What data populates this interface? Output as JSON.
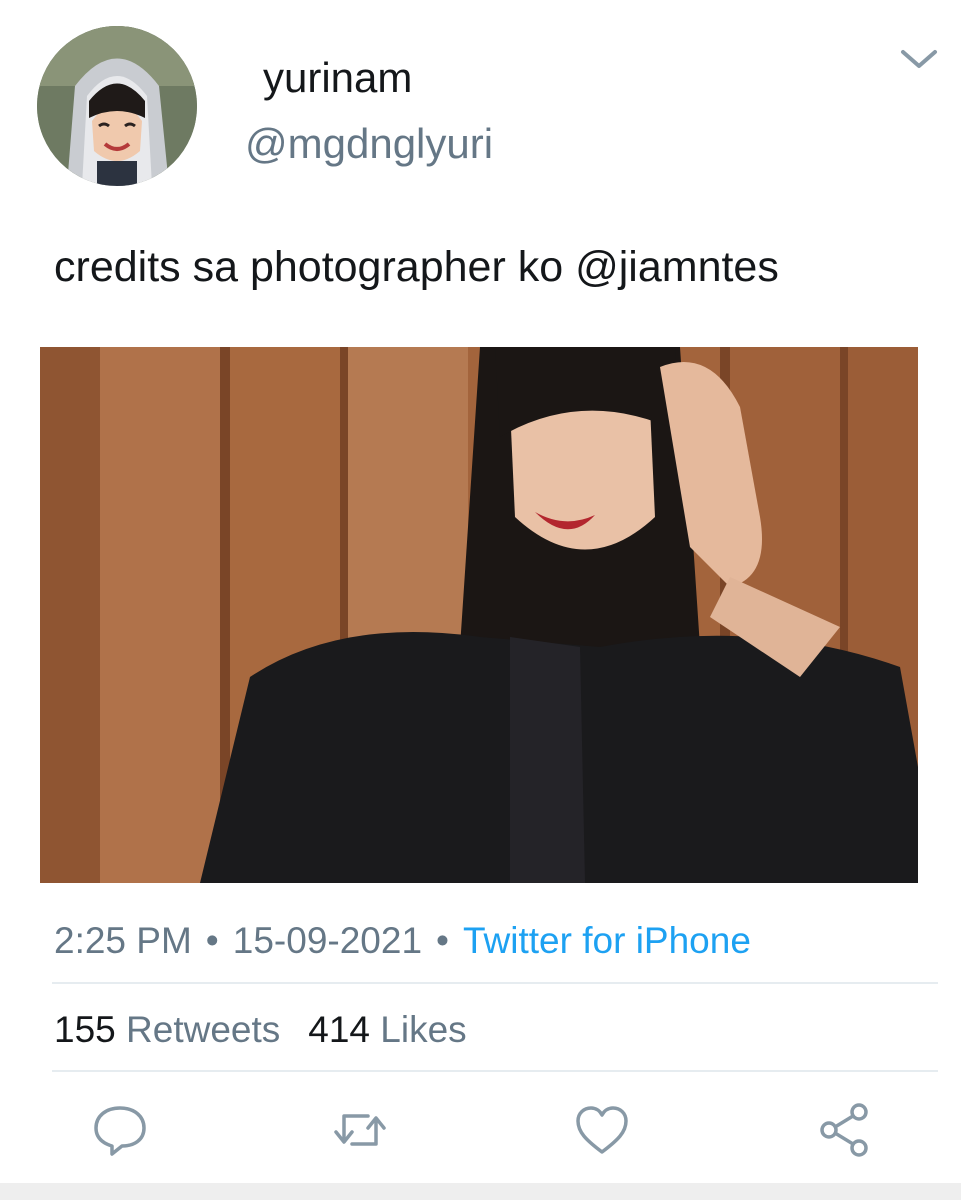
{
  "tweet": {
    "display_name": "yurinam",
    "handle": "@mgdnglyuri",
    "text": "credits sa photographer ko @jiamntes",
    "time": "2:25 PM",
    "date": "15-09-2021",
    "separator": "•",
    "source": "Twitter for iPhone"
  },
  "stats": {
    "retweets_count": "155",
    "retweets_label": "Retweets",
    "likes_count": "414",
    "likes_label": "Likes"
  },
  "icons": {
    "menu": "chevron-down-icon",
    "reply": "reply-icon",
    "retweet": "retweet-icon",
    "like": "heart-icon",
    "share": "share-icon"
  },
  "colors": {
    "primary_text": "#14171a",
    "secondary_text": "#657786",
    "link": "#1da1f2",
    "divider": "#e6ecf0",
    "icon": "#8899a6"
  }
}
